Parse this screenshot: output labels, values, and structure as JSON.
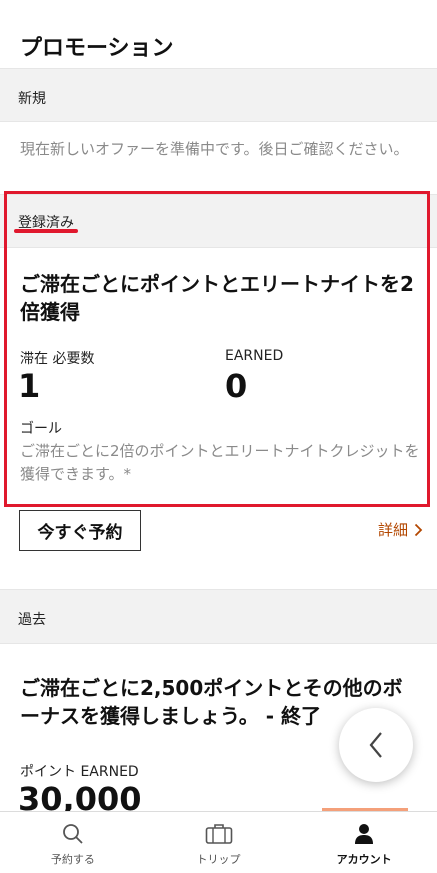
{
  "page": {
    "title": "プロモーション"
  },
  "sections": {
    "new": {
      "header": "新規",
      "empty_text": "現在新しいオファーを準備中です。後日ご確認ください。"
    },
    "registered": {
      "header": "登録済み",
      "offer": {
        "title": "ご滞在ごとにポイントとエリートナイトを2倍獲得",
        "stat1_label": "滞在 必要数",
        "stat1_value": "1",
        "stat2_label": "EARNED",
        "stat2_value": "0",
        "goal_label": "ゴール",
        "goal_text": "ご滞在ごとに2倍のポイントとエリートナイトクレジットを獲得できます。*",
        "book_button": "今すぐ予約",
        "details_link": "詳細"
      }
    },
    "past": {
      "header": "過去",
      "offer": {
        "title": "ご滞在ごとに2,500ポイントとその他のボーナスを獲得しましょう。 - 終了",
        "points_label": "ポイント EARNED",
        "points_value": "30,000"
      }
    }
  },
  "nav": {
    "items": [
      {
        "label": "予約する",
        "icon": "search-icon"
      },
      {
        "label": "トリップ",
        "icon": "suitcase-icon"
      },
      {
        "label": "アカウント",
        "icon": "person-icon",
        "active": true
      }
    ]
  },
  "colors": {
    "highlight": "#e0182d",
    "link": "#b34700",
    "muted": "#8a8a8a"
  }
}
